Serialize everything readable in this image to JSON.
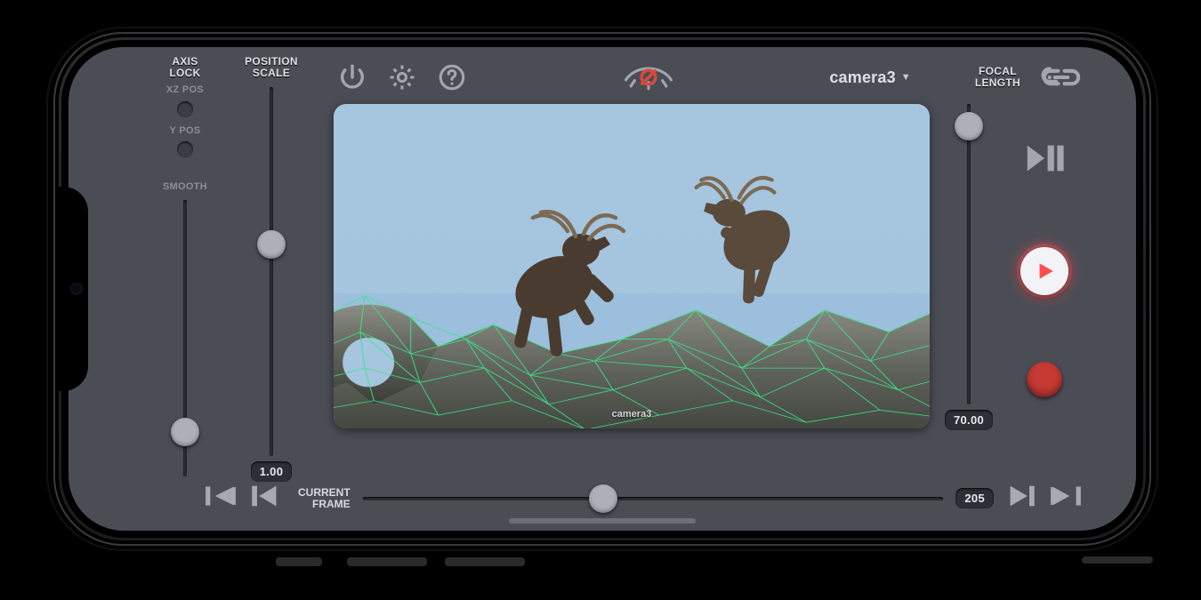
{
  "camera": {
    "name": "camera3"
  },
  "left": {
    "axis_label": "AXIS\nLOCK",
    "scale_label": "POSITION\nSCALE",
    "xz_label": "XZ POS",
    "y_label": "Y POS",
    "smooth_label": "SMOOTH",
    "smooth_pct": 88,
    "scale_value": "1.00",
    "scale_pct": 42
  },
  "focal": {
    "label": "FOCAL\nLENGTH",
    "value": "70.00",
    "pct": 3
  },
  "timeline": {
    "label": "CURRENT\nFRAME",
    "value": "205",
    "pct": 41
  },
  "viewport": {
    "caption": "camera3"
  },
  "icons": {
    "power": "power-icon",
    "gear": "gear-icon",
    "help": "help-icon",
    "eye_off": "visibility-off-icon",
    "link": "link-icon",
    "play_pause": "play-pause-icon",
    "record_play": "record-play-icon",
    "record": "record-icon",
    "first": "first-frame-icon",
    "prev": "prev-frame-icon",
    "next": "next-frame-icon",
    "last": "last-frame-icon"
  }
}
